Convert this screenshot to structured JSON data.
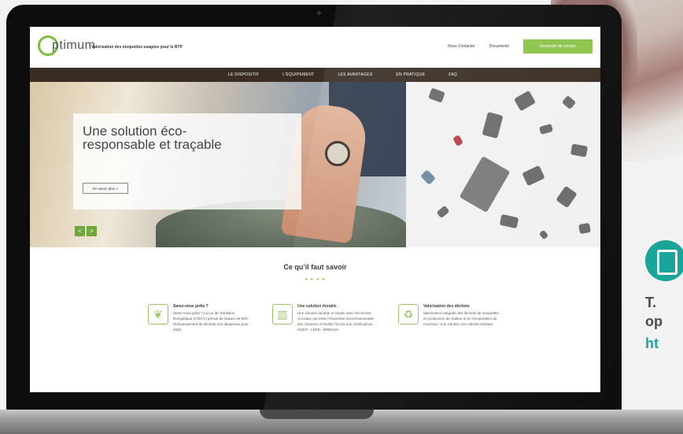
{
  "site": {
    "logo_text": "ptimum",
    "tagline": "Valorisation des moquettes usagées pour le BTP",
    "top_links": [
      "Nous Contacter",
      "Documents"
    ],
    "cta": "Demande de contact"
  },
  "nav": [
    "LE DISPOSITIF",
    "L'ÉQUIPEMENT",
    "LES AVANTAGES",
    "EN PRATIQUE",
    "FAQ"
  ],
  "hero": {
    "title": "Une solution éco-responsable et traçable",
    "button": "En savoir plus  >",
    "prev": "<",
    "next": ">"
  },
  "section": {
    "title": "Ce qu'il faut savoir",
    "dots": "● ● ● ●"
  },
  "features": [
    {
      "icon": "leaf-icon",
      "title": "Serez-vous prêts ?",
      "text": "Serez-vous prêts ? La Loi de Transition Énergétique (LTECV) prévoit de réduire de 50% l'enfouissement de déchets non dangereux pour 2025."
    },
    {
      "icon": "building-icon",
      "title": "Une solution durable",
      "text": "Une solution durable et simple avec l'économie circulaire qui limite l'empreinte environnementale des chantiers et facilite l'accès aux certifications : HQE® - LEED - BREEAM"
    },
    {
      "icon": "recycle-icon",
      "title": "Valorisation des déchets",
      "text": "Valorisation intégrale des déchets de moquettes en production de chaleur et en récupération de minéraux. Une solution zéro déchet résiduel."
    }
  ],
  "side": {
    "line1": "T.",
    "line2": "op",
    "line3": "ht",
    "icon": "tablet-icon"
  },
  "colors": {
    "accent_green": "#8bc34a",
    "nav_brown": "#3a2e24",
    "side_teal": "#19a59a"
  }
}
